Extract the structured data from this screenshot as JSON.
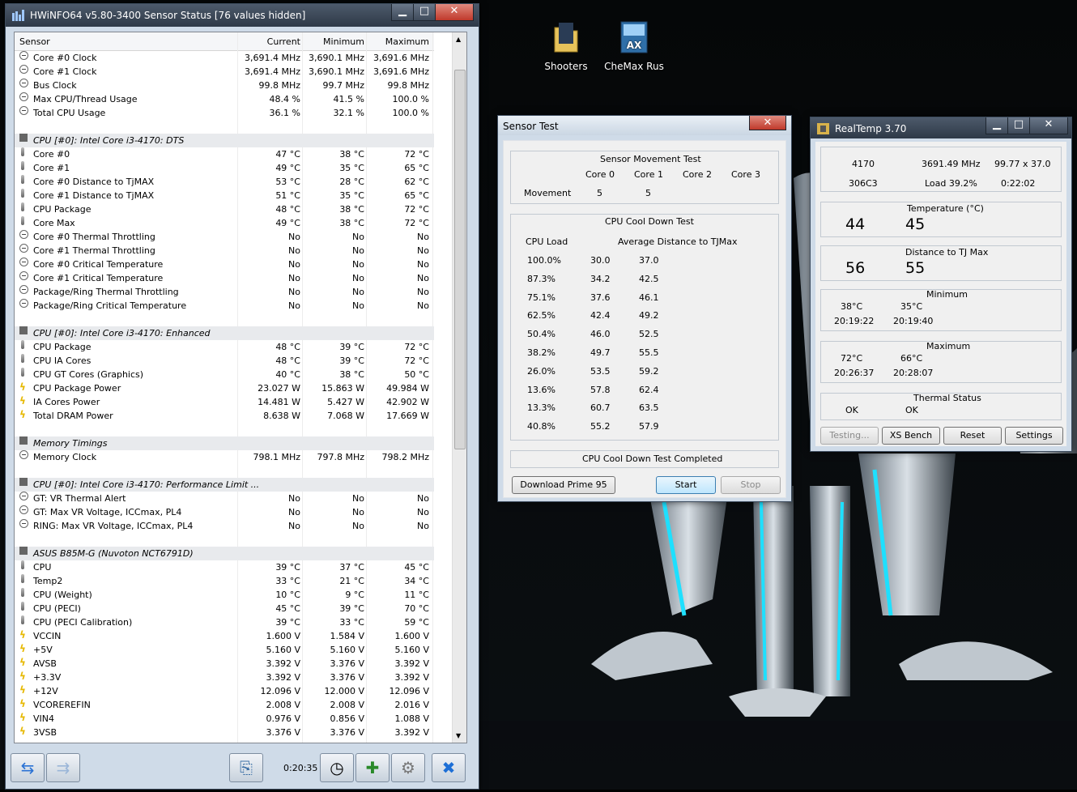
{
  "desktop": {
    "icons": [
      {
        "label": "Shooters",
        "icon": "folder-icon"
      },
      {
        "label": "CheMax Rus",
        "icon": "chemax-app-icon"
      }
    ]
  },
  "hwinfo": {
    "title": "HWiNFO64 v5.80-3400 Sensor Status [76 values hidden]",
    "headers": [
      "Sensor",
      "Current",
      "Minimum",
      "Maximum"
    ],
    "rows": [
      {
        "type": "clk",
        "name": "Core #0 Clock",
        "cur": "3,691.4 MHz",
        "min": "3,690.1 MHz",
        "max": "3,691.6 MHz"
      },
      {
        "type": "clk",
        "name": "Core #1 Clock",
        "cur": "3,691.4 MHz",
        "min": "3,690.1 MHz",
        "max": "3,691.6 MHz"
      },
      {
        "type": "clk",
        "name": "Bus Clock",
        "cur": "99.8 MHz",
        "min": "99.7 MHz",
        "max": "99.8 MHz"
      },
      {
        "type": "clk",
        "name": "Max CPU/Thread Usage",
        "cur": "48.4 %",
        "min": "41.5 %",
        "max": "100.0 %"
      },
      {
        "type": "clk",
        "name": "Total CPU Usage",
        "cur": "36.1 %",
        "min": "32.1 %",
        "max": "100.0 %"
      },
      {
        "type": "blank",
        "name": "",
        "cur": "",
        "min": "",
        "max": ""
      },
      {
        "type": "sec",
        "name": "CPU [#0]: Intel Core i3-4170: DTS",
        "cur": "",
        "min": "",
        "max": ""
      },
      {
        "type": "tmp",
        "name": "Core #0",
        "cur": "47 °C",
        "min": "38 °C",
        "max": "72 °C"
      },
      {
        "type": "tmp",
        "name": "Core #1",
        "cur": "49 °C",
        "min": "35 °C",
        "max": "65 °C"
      },
      {
        "type": "tmp",
        "name": "Core #0 Distance to TjMAX",
        "cur": "53 °C",
        "min": "28 °C",
        "max": "62 °C"
      },
      {
        "type": "tmp",
        "name": "Core #1 Distance to TjMAX",
        "cur": "51 °C",
        "min": "35 °C",
        "max": "65 °C"
      },
      {
        "type": "tmp",
        "name": "CPU Package",
        "cur": "48 °C",
        "min": "38 °C",
        "max": "72 °C"
      },
      {
        "type": "tmp",
        "name": "Core Max",
        "cur": "49 °C",
        "min": "38 °C",
        "max": "72 °C"
      },
      {
        "type": "clk",
        "name": "Core #0 Thermal Throttling",
        "cur": "No",
        "min": "No",
        "max": "No"
      },
      {
        "type": "clk",
        "name": "Core #1 Thermal Throttling",
        "cur": "No",
        "min": "No",
        "max": "No"
      },
      {
        "type": "clk",
        "name": "Core #0 Critical Temperature",
        "cur": "No",
        "min": "No",
        "max": "No"
      },
      {
        "type": "clk",
        "name": "Core #1 Critical Temperature",
        "cur": "No",
        "min": "No",
        "max": "No"
      },
      {
        "type": "clk",
        "name": "Package/Ring Thermal Throttling",
        "cur": "No",
        "min": "No",
        "max": "No"
      },
      {
        "type": "clk",
        "name": "Package/Ring Critical Temperature",
        "cur": "No",
        "min": "No",
        "max": "No"
      },
      {
        "type": "blank",
        "name": "",
        "cur": "",
        "min": "",
        "max": ""
      },
      {
        "type": "sec",
        "name": "CPU [#0]: Intel Core i3-4170: Enhanced",
        "cur": "",
        "min": "",
        "max": ""
      },
      {
        "type": "tmp",
        "name": "CPU Package",
        "cur": "48 °C",
        "min": "39 °C",
        "max": "72 °C"
      },
      {
        "type": "tmp",
        "name": "CPU IA Cores",
        "cur": "48 °C",
        "min": "39 °C",
        "max": "72 °C"
      },
      {
        "type": "tmp",
        "name": "CPU GT Cores (Graphics)",
        "cur": "40 °C",
        "min": "38 °C",
        "max": "50 °C"
      },
      {
        "type": "vlt",
        "name": "CPU Package Power",
        "cur": "23.027 W",
        "min": "15.863 W",
        "max": "49.984 W"
      },
      {
        "type": "vlt",
        "name": "IA Cores Power",
        "cur": "14.481 W",
        "min": "5.427 W",
        "max": "42.902 W"
      },
      {
        "type": "vlt",
        "name": "Total DRAM Power",
        "cur": "8.638 W",
        "min": "7.068 W",
        "max": "17.669 W"
      },
      {
        "type": "blank",
        "name": "",
        "cur": "",
        "min": "",
        "max": ""
      },
      {
        "type": "sec",
        "name": "Memory Timings",
        "cur": "",
        "min": "",
        "max": ""
      },
      {
        "type": "clk",
        "name": "Memory Clock",
        "cur": "798.1 MHz",
        "min": "797.8 MHz",
        "max": "798.2 MHz"
      },
      {
        "type": "blank",
        "name": "",
        "cur": "",
        "min": "",
        "max": ""
      },
      {
        "type": "sec",
        "name": "CPU [#0]: Intel Core i3-4170: Performance Limit ...",
        "cur": "",
        "min": "",
        "max": ""
      },
      {
        "type": "clk",
        "name": "GT: VR Thermal Alert",
        "cur": "No",
        "min": "No",
        "max": "No"
      },
      {
        "type": "clk",
        "name": "GT: Max VR Voltage, ICCmax, PL4",
        "cur": "No",
        "min": "No",
        "max": "No"
      },
      {
        "type": "clk",
        "name": "RING: Max VR Voltage, ICCmax, PL4",
        "cur": "No",
        "min": "No",
        "max": "No"
      },
      {
        "type": "blank",
        "name": "",
        "cur": "",
        "min": "",
        "max": ""
      },
      {
        "type": "sec",
        "name": "ASUS B85M-G (Nuvoton NCT6791D)",
        "cur": "",
        "min": "",
        "max": ""
      },
      {
        "type": "tmp",
        "name": "CPU",
        "cur": "39 °C",
        "min": "37 °C",
        "max": "45 °C"
      },
      {
        "type": "tmp",
        "name": "Temp2",
        "cur": "33 °C",
        "min": "21 °C",
        "max": "34 °C"
      },
      {
        "type": "tmp",
        "name": "CPU (Weight)",
        "cur": "10 °C",
        "min": "9 °C",
        "max": "11 °C"
      },
      {
        "type": "tmp",
        "name": "CPU (PECI)",
        "cur": "45 °C",
        "min": "39 °C",
        "max": "70 °C"
      },
      {
        "type": "tmp",
        "name": "CPU (PECI Calibration)",
        "cur": "39 °C",
        "min": "33 °C",
        "max": "59 °C"
      },
      {
        "type": "vlt",
        "name": "VCCIN",
        "cur": "1.600 V",
        "min": "1.584 V",
        "max": "1.600 V"
      },
      {
        "type": "vlt",
        "name": "+5V",
        "cur": "5.160 V",
        "min": "5.160 V",
        "max": "5.160 V"
      },
      {
        "type": "vlt",
        "name": "AVSB",
        "cur": "3.392 V",
        "min": "3.376 V",
        "max": "3.392 V"
      },
      {
        "type": "vlt",
        "name": "+3.3V",
        "cur": "3.392 V",
        "min": "3.376 V",
        "max": "3.392 V"
      },
      {
        "type": "vlt",
        "name": "+12V",
        "cur": "12.096 V",
        "min": "12.000 V",
        "max": "12.096 V"
      },
      {
        "type": "vlt",
        "name": "VCOREREFIN",
        "cur": "2.008 V",
        "min": "2.008 V",
        "max": "2.016 V"
      },
      {
        "type": "vlt",
        "name": "VIN4",
        "cur": "0.976 V",
        "min": "0.856 V",
        "max": "1.088 V"
      },
      {
        "type": "vlt",
        "name": "3VSB",
        "cur": "3.376 V",
        "min": "3.376 V",
        "max": "3.392 V"
      }
    ],
    "timer": "0:20:35"
  },
  "sensor_test": {
    "title": "Sensor Test",
    "movement_title": "Sensor Movement Test",
    "cores": [
      "Core 0",
      "Core 1",
      "Core 2",
      "Core 3"
    ],
    "movement_label": "Movement",
    "movement_values": [
      "5",
      "5",
      "",
      ""
    ],
    "cool_title": "CPU Cool Down Test",
    "col_load": "CPU Load",
    "col_avg": "Average Distance to TJMax",
    "rows": [
      {
        "load": "100.0%",
        "a": "30.0",
        "b": "37.0"
      },
      {
        "load": "87.3%",
        "a": "34.2",
        "b": "42.5"
      },
      {
        "load": "75.1%",
        "a": "37.6",
        "b": "46.1"
      },
      {
        "load": "62.5%",
        "a": "42.4",
        "b": "49.2"
      },
      {
        "load": "50.4%",
        "a": "46.0",
        "b": "52.5"
      },
      {
        "load": "38.2%",
        "a": "49.7",
        "b": "55.5"
      },
      {
        "load": "26.0%",
        "a": "53.5",
        "b": "59.2"
      },
      {
        "load": "13.6%",
        "a": "57.8",
        "b": "62.4"
      },
      {
        "load": "13.3%",
        "a": "60.7",
        "b": "63.5"
      },
      {
        "load": "40.8%",
        "a": "55.2",
        "b": "57.9"
      }
    ],
    "status": "CPU Cool Down Test Completed",
    "btn_download": "Download Prime 95",
    "btn_start": "Start",
    "btn_stop": "Stop"
  },
  "realtemp": {
    "title": "RealTemp 3.70",
    "cpu": "4170",
    "freq": "3691.49 MHz",
    "mult": "99.77 x 37.0",
    "stepping": "306C3",
    "load": "Load  39.2%",
    "elapsed": "0:22:02",
    "temp_label": "Temperature (°C)",
    "temps": [
      "44",
      "45"
    ],
    "dist_label": "Distance to TJ Max",
    "dists": [
      "56",
      "55"
    ],
    "min_label": "Minimum",
    "mins": [
      "38°C",
      "35°C"
    ],
    "min_times": [
      "20:19:22",
      "20:19:40"
    ],
    "max_label": "Maximum",
    "maxs": [
      "72°C",
      "66°C"
    ],
    "max_times": [
      "20:26:37",
      "20:28:07"
    ],
    "thermal_label": "Thermal Status",
    "thermal": [
      "OK",
      "OK"
    ],
    "buttons": [
      "Testing...",
      "XS Bench",
      "Reset",
      "Settings"
    ]
  }
}
